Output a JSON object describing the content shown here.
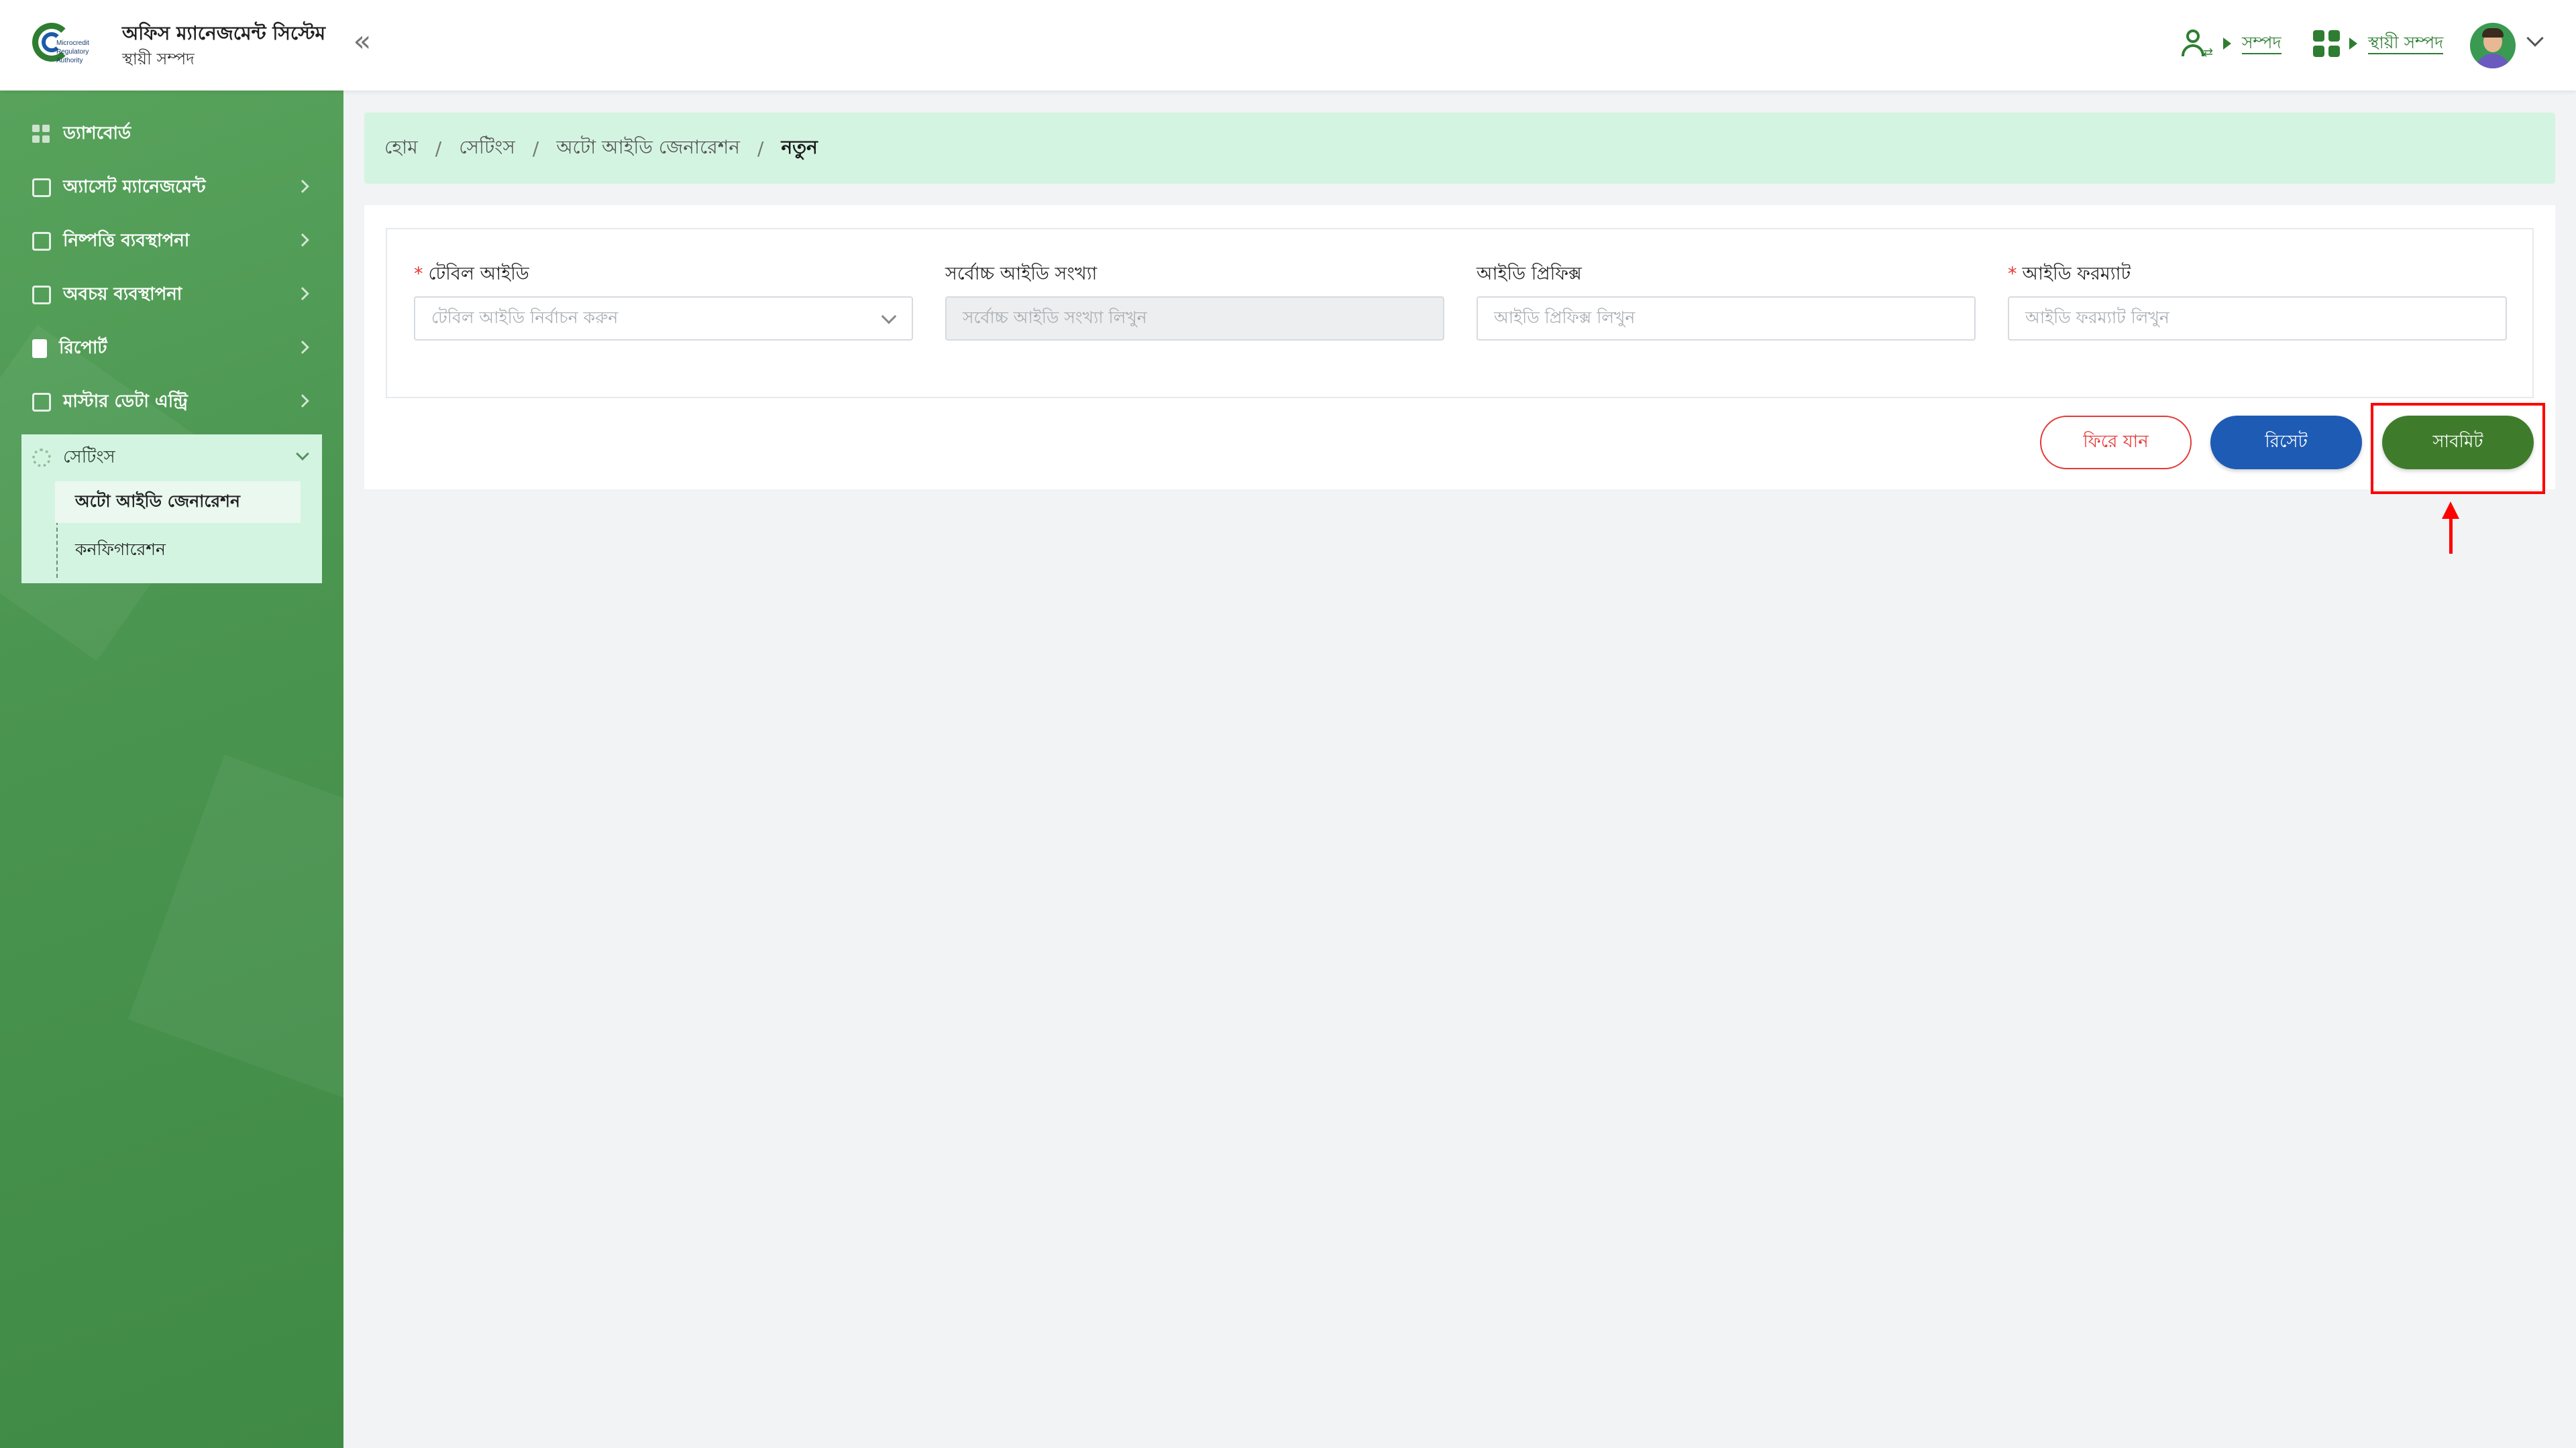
{
  "header": {
    "logo_text": "Microcredit Regulatory Authority",
    "app_title": "অফিস ম্যানেজমেন্ট সিস্টেম",
    "app_subtitle": "স্থায়ী সম্পদ",
    "module_link_1": "সম্পদ",
    "module_link_2": "স্থায়ী সম্পদ",
    "icons": [
      "user-switch-icon",
      "apps-grid-icon",
      "chevron-down-icon"
    ]
  },
  "sidebar": {
    "items": [
      {
        "label": "ড্যাশবোর্ড",
        "icon": "dashboard-icon"
      },
      {
        "label": "অ্যাসেট ম্যানেজমেন্ট",
        "icon": "asset-icon"
      },
      {
        "label": "নিষ্পত্তি ব্যবস্থাপনা",
        "icon": "disposal-icon"
      },
      {
        "label": "অবচয় ব্যবস্থাপনা",
        "icon": "depreciation-icon"
      },
      {
        "label": "রিপোর্ট",
        "icon": "report-icon"
      },
      {
        "label": "মাস্টার ডেটা এন্ট্রি",
        "icon": "master-data-icon"
      }
    ],
    "settings": {
      "label": "সেটিংস",
      "sub_items": [
        {
          "label": "অটো আইডি জেনারেশন",
          "active": true
        },
        {
          "label": "কনফিগারেশন",
          "active": false
        }
      ]
    }
  },
  "breadcrumb": {
    "items": [
      "হোম",
      "সেটিংস",
      "অটো আইডি জেনারেশন"
    ],
    "separator": "/",
    "current": "নতুন"
  },
  "form": {
    "required_mark": "*",
    "table_id": {
      "label": "টেবিল আইডি",
      "placeholder": "টেবিল আইডি নির্বাচন করুন"
    },
    "max_id": {
      "label": "সর্বোচ্চ আইডি সংখ্যা",
      "placeholder": "সর্বোচ্চ আইডি সংখ্যা লিখুন"
    },
    "id_prefix": {
      "label": "আইডি প্রিফিক্স",
      "placeholder": "আইডি প্রিফিক্স লিখুন"
    },
    "id_format": {
      "label": "আইডি ফরম্যাট",
      "placeholder": "আইডি ফরম্যাট লিখুন"
    }
  },
  "buttons": {
    "back": "ফিরে যান",
    "reset": "রিসেট",
    "submit": "সাবমিট"
  },
  "colors": {
    "brand_green": "#2e7d32",
    "sidebar_green": "#4a9550",
    "breadcrumb_bg": "#d4f4e2",
    "reset_blue": "#1e5bb5",
    "submit_green": "#3e7c2c",
    "back_red": "#e53935",
    "annotation_red": "#ff0000"
  }
}
